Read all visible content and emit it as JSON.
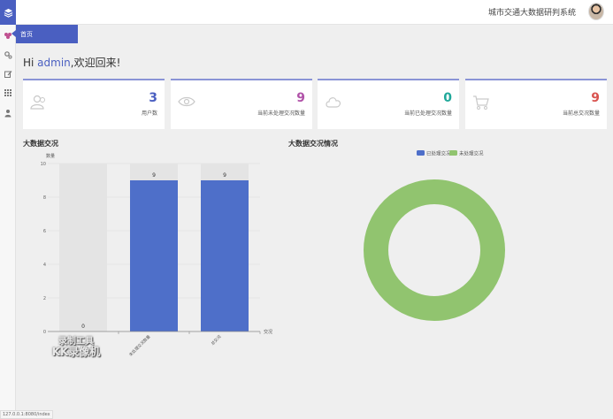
{
  "header": {
    "title": "城市交通大数据研判系统"
  },
  "tab": {
    "label": "首页"
  },
  "greeting": {
    "prefix": "Hi ",
    "user": "admin",
    "suffix": ",欢迎回来!"
  },
  "cards": [
    {
      "value": "3",
      "label": "用户数",
      "color": "#4a5fc1",
      "icon": "users-icon"
    },
    {
      "value": "9",
      "label": "当前未处理交况数量",
      "color": "#b052a8",
      "icon": "eye-icon"
    },
    {
      "value": "0",
      "label": "当前已处理交况数量",
      "color": "#20a89a",
      "icon": "cloud-icon"
    },
    {
      "value": "9",
      "label": "当前总交况数量",
      "color": "#d9534f",
      "icon": "cart-icon"
    }
  ],
  "sections": {
    "left": "大数据交况",
    "right": "大数据交况情况"
  },
  "chart_data": [
    {
      "type": "bar",
      "title": "大数据交况",
      "ylabel": "数量",
      "xlabel": "交况",
      "categories": [
        "",
        "未处理交况数量",
        "总交况"
      ],
      "values": [
        0,
        9,
        9
      ],
      "ylim": [
        0,
        10
      ],
      "yticks": [
        0,
        2,
        4,
        6,
        8,
        10
      ],
      "color": "#4e6fc9",
      "background_color": "#e4e4e4",
      "grid": true
    },
    {
      "type": "pie",
      "title": "大数据交况情况",
      "donut": true,
      "legend_position": "top",
      "slices": [
        {
          "name": "已处理交况",
          "value": 0,
          "color": "#4e6fc9"
        },
        {
          "name": "未处理交况",
          "value": 9,
          "color": "#91c46f"
        }
      ]
    }
  ],
  "watermark": {
    "line1": "录制工具",
    "line2": "KK录像机"
  },
  "status": {
    "url": "127.0.0.1:8080/index"
  }
}
